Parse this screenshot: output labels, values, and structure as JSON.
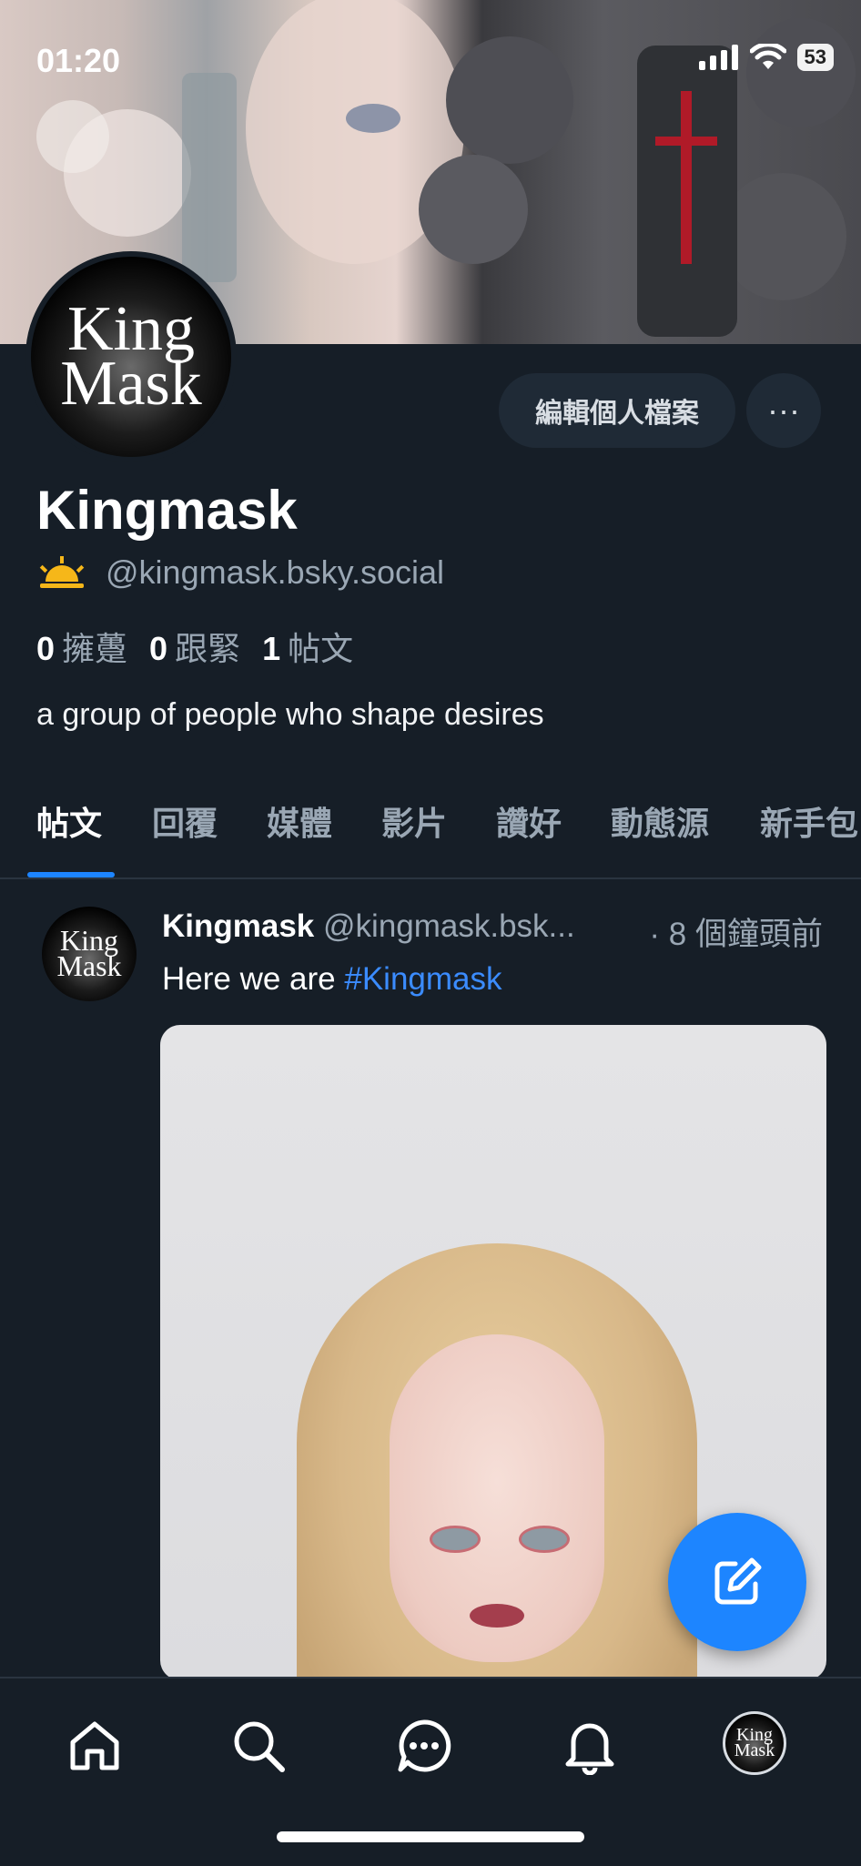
{
  "status_bar": {
    "time": "01:20",
    "battery": "53"
  },
  "profile": {
    "display_name": "Kingmask",
    "handle": "@kingmask.bsky.social",
    "avatar_text_line1": "King",
    "avatar_text_line2": "Mask",
    "edit_button": "編輯個人檔案",
    "more_button": "···",
    "stats": {
      "followers_count": "0",
      "followers_label": "擁躉",
      "following_count": "0",
      "following_label": "跟緊",
      "posts_count": "1",
      "posts_label": "帖文"
    },
    "bio": "a group of people who shape desires"
  },
  "tabs": [
    {
      "label": "帖文",
      "active": true
    },
    {
      "label": "回覆"
    },
    {
      "label": "媒體"
    },
    {
      "label": "影片"
    },
    {
      "label": "讚好"
    },
    {
      "label": "動態源"
    },
    {
      "label": "新手包"
    }
  ],
  "post": {
    "author": "Kingmask",
    "handle": "@kingmask.bsk...",
    "time": "· 8 個鐘頭前",
    "text": "Here we are ",
    "hashtag": "#Kingmask"
  },
  "bottom_nav": [
    "home-icon",
    "search-icon",
    "chat-icon",
    "bell-icon",
    "profile-avatar"
  ],
  "colors": {
    "background": "#161e27",
    "accent": "#1d85ff",
    "muted": "#9aa7b4"
  }
}
